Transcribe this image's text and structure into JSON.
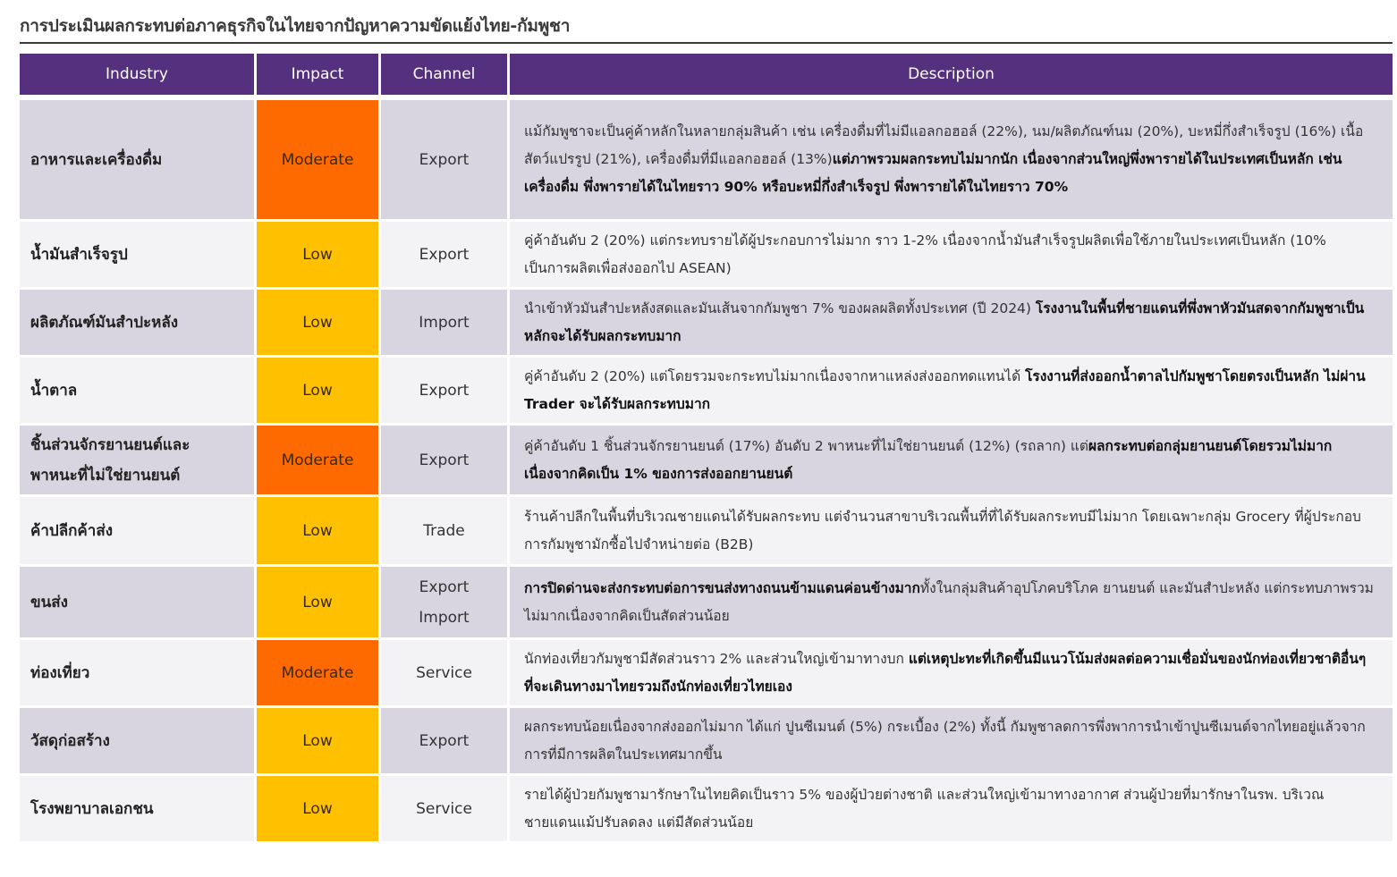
{
  "page": {
    "title": "การประเมินผลกระทบต่อภาคธุรกิจในไทยจากปัญหาความขัดแย้งไทย-กัมพูชา"
  },
  "colors": {
    "header_bg": "#55307f",
    "moderate": "#ff6a00",
    "low": "#ffc000",
    "row_odd": "#d8d5e0",
    "row_even": "#f3f3f6"
  },
  "table": {
    "headers": [
      "Industry",
      "Impact",
      "Channel",
      "Description"
    ],
    "rows": [
      {
        "industry": [
          "อาหารและเครื่องดื่ม"
        ],
        "impact": "Moderate",
        "channel": [
          "Export"
        ],
        "desc_normal": "แม้กัมพูชาจะเป็นคู่ค้าหลักในหลายกลุ่มสินค้า เช่น เครื่องดื่มที่ไม่มีแอลกอฮอล์ (22%), นม/ผลิตภัณฑ์นม (20%), บะหมี่กึ่งสำเร็จรูป (16%) เนื้อสัตว์แปรรูป (21%), เครื่องดื่มที่มีแอลกอฮอล์ (13%)",
        "desc_bold": "แต่ภาพรวมผลกระทบไม่มากนัก เนื่องจากส่วนใหญ่พึ่งพารายได้ในประเทศเป็นหลัก เช่น เครื่องดื่ม พึ่งพารายได้ในไทยราว 90% หรือบะหมี่กึ่งสำเร็จรูป พึ่งพารายได้ในไทยราว 70%",
        "desc_tail": ""
      },
      {
        "industry": [
          "น้ำมันสำเร็จรูป"
        ],
        "impact": "Low",
        "channel": [
          "Export"
        ],
        "desc_normal": "คู่ค้าอันดับ 2 (20%) แต่กระทบรายได้ผู้ประกอบการไม่มาก ราว 1-2% เนื่องจากน้ำมันสำเร็จรูปผลิตเพื่อใช้ภายในประเทศเป็นหลัก (10% เป็นการผลิตเพื่อส่งออกไป ASEAN)",
        "desc_bold": "",
        "desc_tail": ""
      },
      {
        "industry": [
          "ผลิตภัณฑ์มันสำปะหลัง"
        ],
        "impact": "Low",
        "channel": [
          "Import"
        ],
        "desc_normal": "นำเข้าหัวมันสำปะหลังสดและมันเส้นจากกัมพูชา 7% ของผลผลิตทั้งประเทศ (ปี 2024) ",
        "desc_bold": "โรงงานในพื้นที่ชายแดนที่พึ่งพาหัวมันสดจากกัมพูชาเป็นหลักจะได้รับผลกระทบมาก",
        "desc_tail": ""
      },
      {
        "industry": [
          "น้ำตาล"
        ],
        "impact": "Low",
        "channel": [
          "Export"
        ],
        "desc_normal": "คู่ค้าอันดับ 2 (20%) แต่โดยรวมจะกระทบไม่มากเนื่องจากหาแหล่งส่งออกทดแทนได้ ",
        "desc_bold": "โรงงานที่ส่งออกน้ำตาลไปกัมพูชาโดยตรงเป็นหลัก ไม่ผ่าน Trader จะได้รับผลกระทบมาก",
        "desc_tail": ""
      },
      {
        "industry": [
          "ชิ้นส่วนจักรยานยนต์และ",
          "พาหนะที่ไม่ใช่ยานยนต์"
        ],
        "impact": "Moderate",
        "channel": [
          "Export"
        ],
        "desc_normal": "คู่ค้าอันดับ 1 ชิ้นส่วนจักรยานยนต์ (17%) อันดับ 2 พาหนะที่ไม่ใช่ยานยนต์ (12%) (รถลาก) แต่",
        "desc_bold": "ผลกระทบต่อกลุ่มยานยนต์โดยรวมไม่มากเนื่องจากคิดเป็น 1% ของการส่งออกยานยนต์",
        "desc_tail": ""
      },
      {
        "industry": [
          "ค้าปลีกค้าส่ง"
        ],
        "impact": "Low",
        "channel": [
          "Trade"
        ],
        "desc_normal": "ร้านค้าปลีกในพื้นที่บริเวณชายแดนได้รับผลกระทบ แต่จำนวนสาขาบริเวณพื้นที่ที่ได้รับผลกระทบมีไม่มาก โดยเฉพาะกลุ่ม Grocery ที่ผู้ประกอบการกัมพูชามักซื้อไปจำหน่ายต่อ (B2B)",
        "desc_bold": "",
        "desc_tail": ""
      },
      {
        "industry": [
          "ขนส่ง"
        ],
        "impact": "Low",
        "channel": [
          "Export",
          "Import"
        ],
        "desc_normal": "",
        "desc_bold": "การปิดด่านจะส่งกระทบต่อการขนส่งทางถนนข้ามแดนค่อนข้างมาก",
        "desc_tail": "ทั้งในกลุ่มสินค้าอุปโภคบริโภค ยานยนต์ และมันสำปะหลัง แต่กระทบภาพรวมไม่มากเนื่องจากคิดเป็นสัดส่วนน้อย"
      },
      {
        "industry": [
          "ท่องเที่ยว"
        ],
        "impact": "Moderate",
        "channel": [
          "Service"
        ],
        "desc_normal": "นักท่องเที่ยวกัมพูชามีสัดส่วนราว 2% และส่วนใหญ่เข้ามาทางบก ",
        "desc_bold": "แต่เหตุปะทะที่เกิดขึ้นมีแนวโน้มส่งผลต่อความเชื่อมั่นของนักท่องเที่ยวชาติอื่นๆ ที่จะเดินทางมาไทยรวมถึงนักท่องเที่ยวไทยเอง",
        "desc_tail": ""
      },
      {
        "industry": [
          "วัสดุก่อสร้าง"
        ],
        "impact": "Low",
        "channel": [
          "Export"
        ],
        "desc_normal": "ผลกระทบน้อยเนื่องจากส่งออกไม่มาก ได้แก่ ปูนซีเมนต์ (5%) กระเบื้อง (2%) ทั้งนี้ กัมพูชาลดการพึ่งพาการนำเข้าปูนซีเมนต์จากไทยอยู่แล้วจากการที่มีการผลิตในประเทศมากขึ้น",
        "desc_bold": "",
        "desc_tail": ""
      },
      {
        "industry": [
          "โรงพยาบาลเอกชน"
        ],
        "impact": "Low",
        "channel": [
          "Service"
        ],
        "desc_normal": "รายได้ผู้ป่วยกัมพูชามารักษาในไทยคิดเป็นราว 5% ของผู้ป่วยต่างชาติ และส่วนใหญ่เข้ามาทางอากาศ ส่วนผู้ป่วยที่มารักษาในรพ. บริเวณชายแดนแม้ปรับลดลง แต่มีสัดส่วนน้อย",
        "desc_bold": "",
        "desc_tail": ""
      }
    ]
  }
}
